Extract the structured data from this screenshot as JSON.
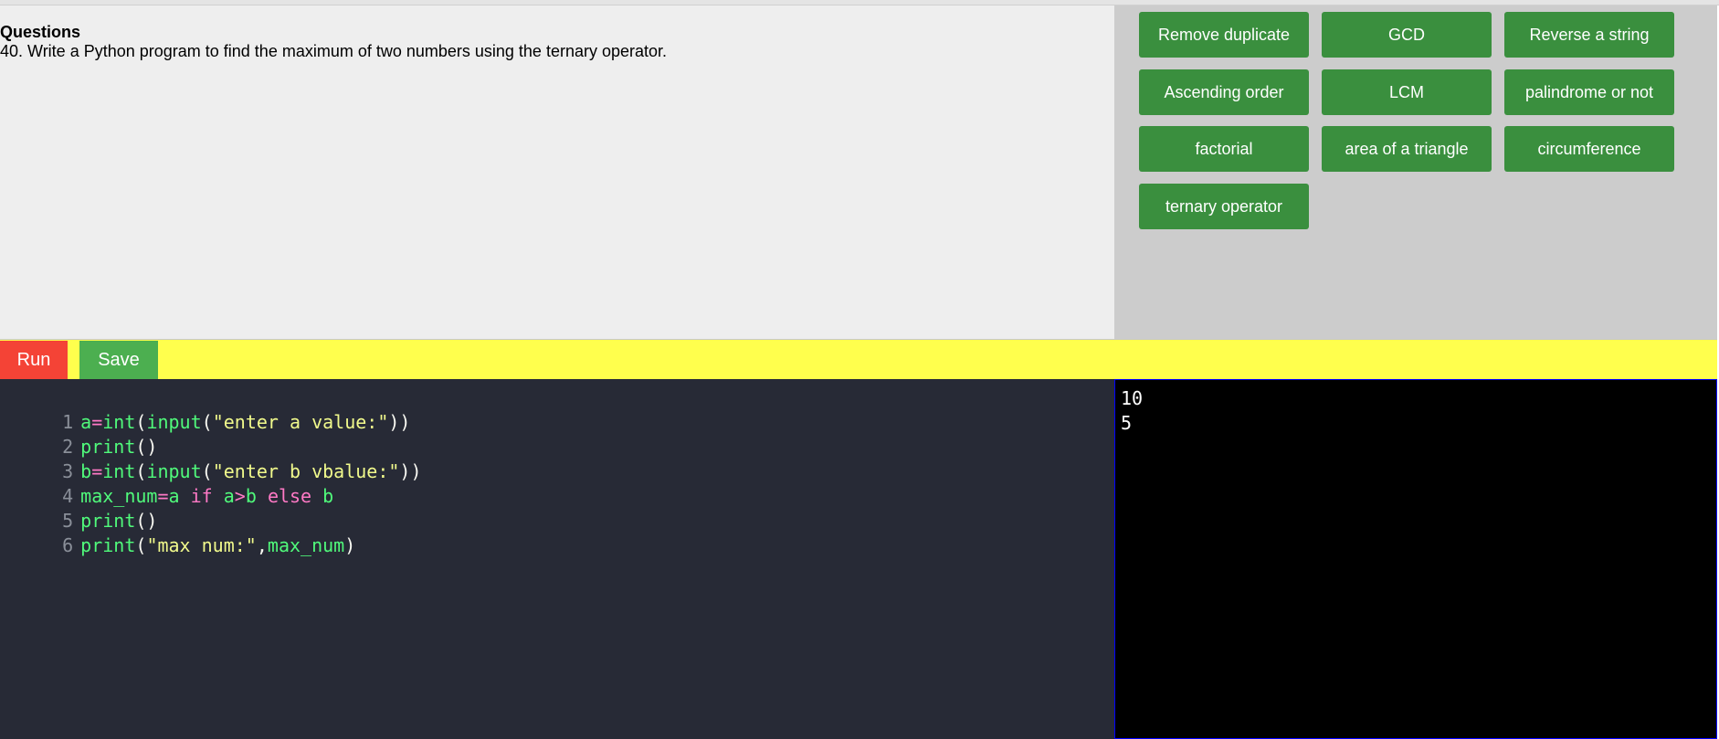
{
  "questions": {
    "title": "Questions",
    "text": "40. Write a Python program to find the maximum of two numbers using the ternary operator."
  },
  "topics": [
    "Remove duplicate",
    "GCD",
    "Reverse a string",
    "Ascending order",
    "LCM",
    "palindrome or not",
    "factorial",
    "area of a triangle",
    "circumference",
    "ternary operator"
  ],
  "toolbar": {
    "run_label": "Run",
    "save_label": "Save"
  },
  "editor": {
    "line_numbers": [
      "1",
      "2",
      "3",
      "4",
      "5",
      "6"
    ],
    "tokens": {
      "l1": [
        "a",
        "=",
        "int",
        "(",
        "input",
        "(",
        "\"enter a value:\"",
        "))"
      ],
      "l2": [
        "print",
        "()"
      ],
      "l3": [
        "b",
        "=",
        "int",
        "(",
        "input",
        "(",
        "\"enter b vbalue:\"",
        "))"
      ],
      "l4": [
        "max_num",
        "=",
        "a",
        " ",
        "if",
        " ",
        "a",
        ">",
        "b",
        " ",
        "else",
        " ",
        "b"
      ],
      "l5": [
        "print",
        "()"
      ],
      "l6": [
        "print",
        "(",
        "\"max num:\"",
        ",",
        "max_num",
        ")"
      ]
    }
  },
  "console": {
    "lines": [
      "10",
      "5"
    ]
  },
  "colors": {
    "topic_button": "#3a8f3e",
    "run_button": "#f44336",
    "save_button": "#4caf50",
    "toolbar": "#ffff4d",
    "editor_bg": "#272a36",
    "console_bg": "#000000"
  }
}
